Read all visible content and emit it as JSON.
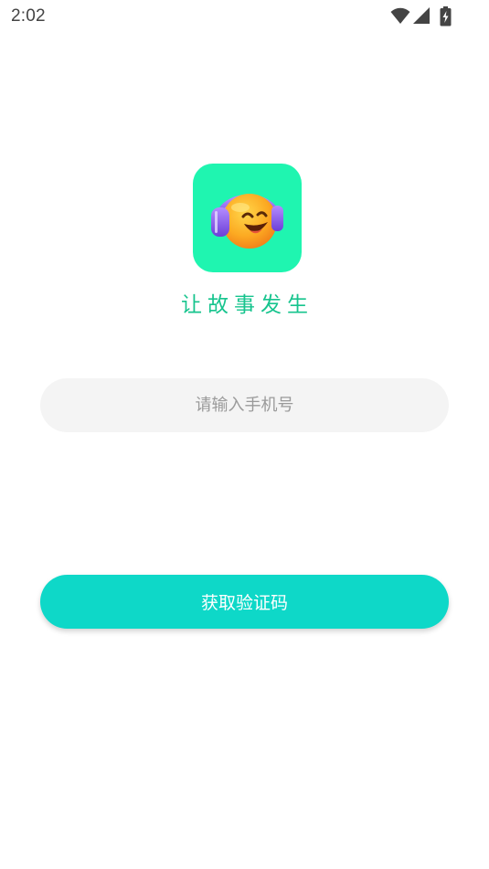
{
  "status_bar": {
    "time": "2:02",
    "icons": [
      "wifi-icon",
      "cellular-signal-icon",
      "battery-charging-icon"
    ],
    "icon_color": "#444444"
  },
  "logo": {
    "icon": "emoji-headphones-icon",
    "background": "#1ff5b0"
  },
  "slogan": "让故事发生",
  "phone_input": {
    "value": "",
    "placeholder": "请输入手机号"
  },
  "get_code_button": {
    "label": "获取验证码",
    "color": "#0ed8c8"
  },
  "colors": {
    "accent": "#0ed8c8",
    "slogan": "#17c48e",
    "input_background": "#f4f4f4"
  }
}
